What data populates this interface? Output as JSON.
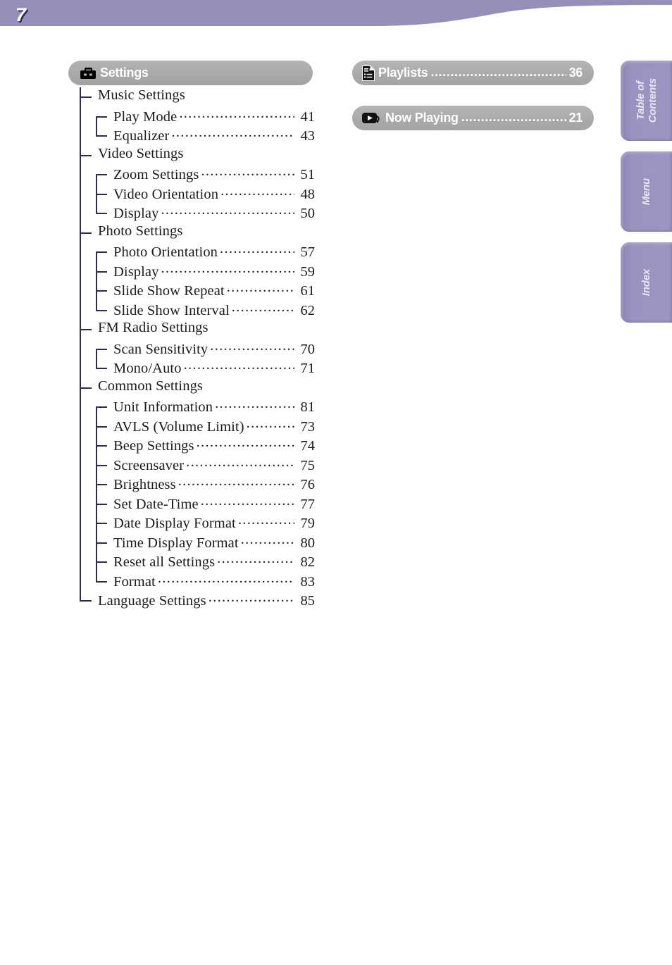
{
  "header": {
    "page_number": "7",
    "band_color": "#9590ba"
  },
  "settings_section": {
    "icon": "toolbox-icon",
    "title": "Settings",
    "pill_color": "#ababab",
    "entries": [
      {
        "level": 1,
        "label": "Music Settings",
        "page": ""
      },
      {
        "level": 2,
        "label": "Play Mode",
        "page": "41"
      },
      {
        "level": 2,
        "label": "Equalizer",
        "page": "43"
      },
      {
        "level": 1,
        "label": "Video Settings",
        "page": ""
      },
      {
        "level": 2,
        "label": "Zoom Settings",
        "page": "51"
      },
      {
        "level": 2,
        "label": "Video Orientation",
        "page": "48"
      },
      {
        "level": 2,
        "label": "Display",
        "page": "50"
      },
      {
        "level": 1,
        "label": "Photo Settings",
        "page": ""
      },
      {
        "level": 2,
        "label": "Photo Orientation",
        "page": "57"
      },
      {
        "level": 2,
        "label": "Display",
        "page": "59"
      },
      {
        "level": 2,
        "label": "Slide Show Repeat",
        "page": "61"
      },
      {
        "level": 2,
        "label": "Slide Show Interval",
        "page": "62"
      },
      {
        "level": 1,
        "label": "FM Radio Settings",
        "page": ""
      },
      {
        "level": 2,
        "label": "Scan Sensitivity",
        "page": "70"
      },
      {
        "level": 2,
        "label": "Mono/Auto",
        "page": "71"
      },
      {
        "level": 1,
        "label": "Common Settings",
        "page": ""
      },
      {
        "level": 2,
        "label": "Unit Information",
        "page": "81"
      },
      {
        "level": 2,
        "label": "AVLS (Volume Limit)",
        "page": "73"
      },
      {
        "level": 2,
        "label": "Beep Settings",
        "page": "74"
      },
      {
        "level": 2,
        "label": "Screensaver",
        "page": "75"
      },
      {
        "level": 2,
        "label": "Brightness",
        "page": "76"
      },
      {
        "level": 2,
        "label": "Set Date-Time",
        "page": "77"
      },
      {
        "level": 2,
        "label": "Date Display Format",
        "page": "79"
      },
      {
        "level": 2,
        "label": "Time Display Format",
        "page": "80"
      },
      {
        "level": 2,
        "label": "Reset all Settings",
        "page": "82"
      },
      {
        "level": 2,
        "label": "Format",
        "page": "83"
      },
      {
        "level": 1,
        "label": "Language Settings",
        "page": "85"
      }
    ]
  },
  "nav_pills": [
    {
      "icon": "playlist-document-icon",
      "label": "Playlists",
      "page": "36"
    },
    {
      "icon": "now-playing-icon",
      "label": "Now Playing",
      "page": "21"
    }
  ],
  "side_tabs": [
    {
      "id": "toc",
      "label": "Table of\nContents",
      "color": "#9a93c0"
    },
    {
      "id": "menu",
      "label": "Menu",
      "color": "#9a93c0"
    },
    {
      "id": "index",
      "label": "Index",
      "color": "#9a93c0"
    }
  ]
}
